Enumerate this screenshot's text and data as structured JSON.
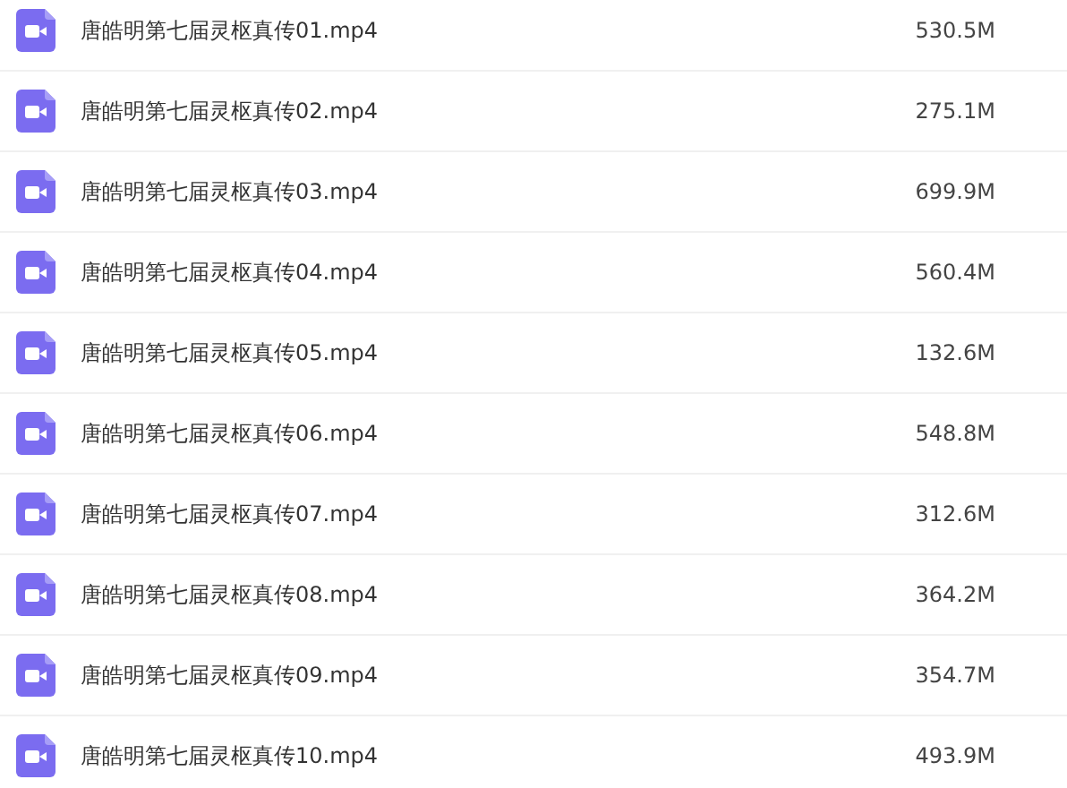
{
  "files": [
    {
      "name": "唐皓明第七届灵枢真传01.mp4",
      "size": "530.5M"
    },
    {
      "name": "唐皓明第七届灵枢真传02.mp4",
      "size": "275.1M"
    },
    {
      "name": "唐皓明第七届灵枢真传03.mp4",
      "size": "699.9M"
    },
    {
      "name": "唐皓明第七届灵枢真传04.mp4",
      "size": "560.4M"
    },
    {
      "name": "唐皓明第七届灵枢真传05.mp4",
      "size": "132.6M"
    },
    {
      "name": "唐皓明第七届灵枢真传06.mp4",
      "size": "548.8M"
    },
    {
      "name": "唐皓明第七届灵枢真传07.mp4",
      "size": "312.6M"
    },
    {
      "name": "唐皓明第七届灵枢真传08.mp4",
      "size": "364.2M"
    },
    {
      "name": "唐皓明第七届灵枢真传09.mp4",
      "size": "354.7M"
    },
    {
      "name": "唐皓明第七届灵枢真传10.mp4",
      "size": "493.9M"
    }
  ]
}
